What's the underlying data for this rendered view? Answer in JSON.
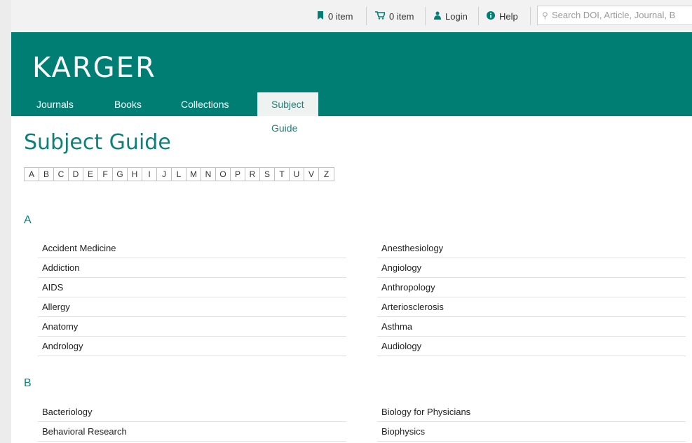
{
  "topbar": {
    "bookmark": {
      "label": "0 item"
    },
    "cart": {
      "label": "0 item"
    },
    "login": {
      "label": "Login"
    },
    "help": {
      "label": "Help"
    },
    "search": {
      "placeholder": "Search DOI, Article, Journal, B"
    }
  },
  "brand": {
    "logo": "KARGER"
  },
  "nav": [
    "Journals",
    "Books",
    "Collections",
    "Subject Guide"
  ],
  "page": {
    "title": "Subject Guide"
  },
  "alphabet": [
    "A",
    "B",
    "C",
    "D",
    "E",
    "F",
    "G",
    "H",
    "I",
    "J",
    "L",
    "M",
    "N",
    "O",
    "P",
    "R",
    "S",
    "T",
    "U",
    "V",
    "Z"
  ],
  "sections": {
    "A": {
      "letter": "A",
      "left": [
        "Accident Medicine",
        "Addiction",
        "AIDS",
        "Allergy",
        "Anatomy",
        "Andrology"
      ],
      "right": [
        "Anesthesiology",
        "Angiology",
        "Anthropology",
        "Arteriosclerosis",
        "Asthma",
        "Audiology"
      ]
    },
    "B": {
      "letter": "B",
      "left": [
        "Bacteriology",
        "Behavioral Research"
      ],
      "right": [
        "Biology for Physicians",
        "Biophysics"
      ]
    }
  },
  "colors": {
    "brand": "#007e73",
    "accent_text": "#0f7f77"
  }
}
